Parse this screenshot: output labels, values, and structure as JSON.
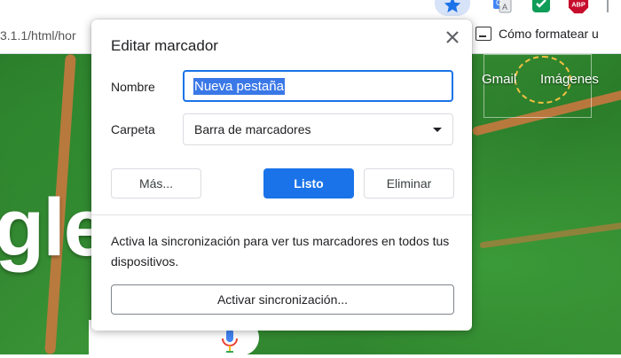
{
  "browser": {
    "url_fragment": "3.1.1/html/hor",
    "bookmark_bar_item": "Cómo formatear u",
    "extensions": [
      {
        "icon": "bookmark-star-icon",
        "color": "#1a73e8"
      },
      {
        "icon": "google-translate-icon",
        "color": "#4285f4"
      },
      {
        "icon": "green-extension-icon",
        "color": "#0f9d58"
      },
      {
        "icon": "adblock-plus-icon",
        "label": "ABP",
        "color": "#c70d2c"
      }
    ]
  },
  "page": {
    "links": [
      "Gmail",
      "Imágenes"
    ],
    "logo_fragment": "gle"
  },
  "dialog": {
    "title": "Editar marcador",
    "name_label": "Nombre",
    "name_value": "Nueva pestaña",
    "folder_label": "Carpeta",
    "folder_value": "Barra de marcadores",
    "buttons": {
      "more": "Más...",
      "done": "Listo",
      "remove": "Eliminar"
    },
    "sync_text": "Activa la sincronización para ver tus marcadores en todos tus dispositivos.",
    "sync_button": "Activar sincronización...",
    "accent_color": "#1a73e8"
  }
}
